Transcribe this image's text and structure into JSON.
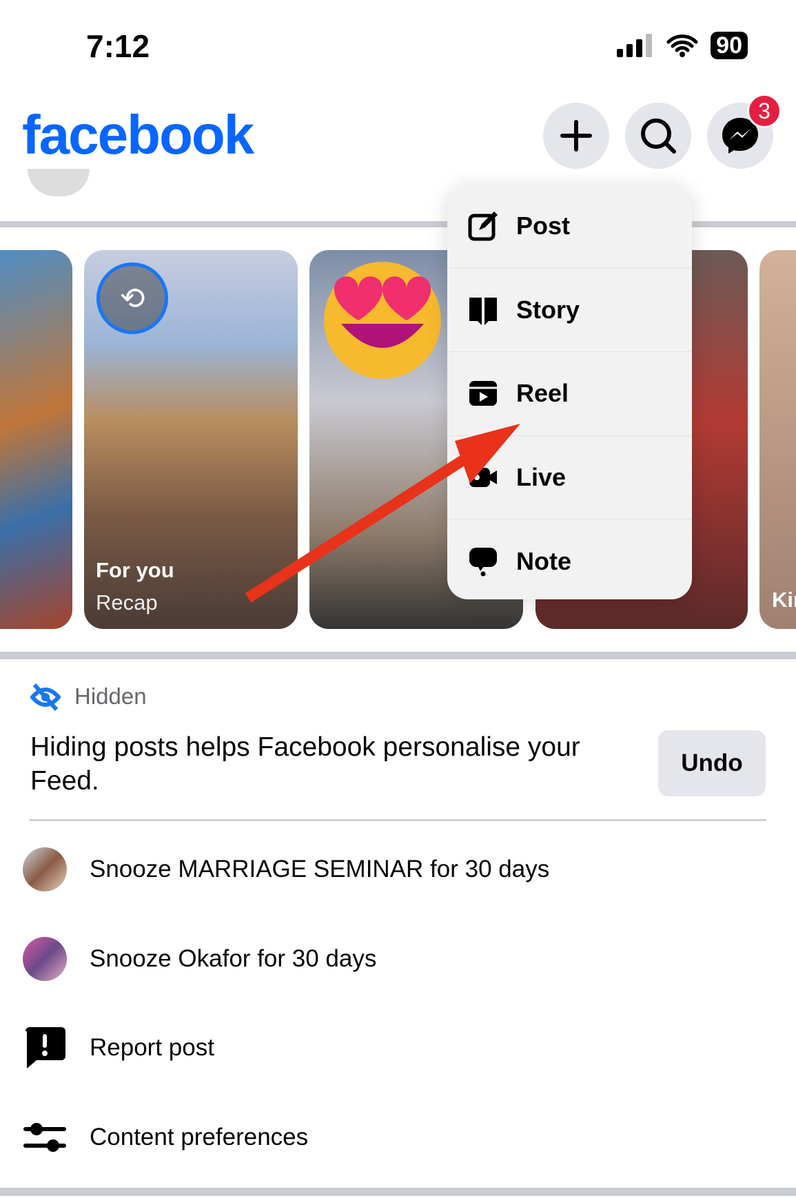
{
  "status_bar": {
    "time": "7:12",
    "battery": "90"
  },
  "header": {
    "logo": "facebook",
    "messenger_badge": "3",
    "icons": [
      "plus-icon",
      "search-icon",
      "messenger-icon"
    ]
  },
  "stories": [
    {
      "label": "For you",
      "sublabel": "Recap"
    },
    {
      "label": "Kir"
    }
  ],
  "create_menu": {
    "items": [
      {
        "label": "Post",
        "icon": "edit-icon"
      },
      {
        "label": "Story",
        "icon": "book-icon"
      },
      {
        "label": "Reel",
        "icon": "reel-icon"
      },
      {
        "label": "Live",
        "icon": "video-camera-icon"
      },
      {
        "label": "Note",
        "icon": "speech-bubble-icon"
      }
    ]
  },
  "hidden_notice": {
    "label": "Hidden",
    "message": "Hiding posts helps Facebook personalise your Feed.",
    "undo": "Undo"
  },
  "options": [
    {
      "label": "Snooze MARRIAGE SEMINAR for 30 days"
    },
    {
      "label": "Snooze Okafor for 30 days"
    },
    {
      "label": "Report post"
    },
    {
      "label": "Content preferences"
    }
  ],
  "colors": {
    "brand": "#0866ff",
    "badge": "#e41e3f",
    "arrow": "#e8321a"
  }
}
